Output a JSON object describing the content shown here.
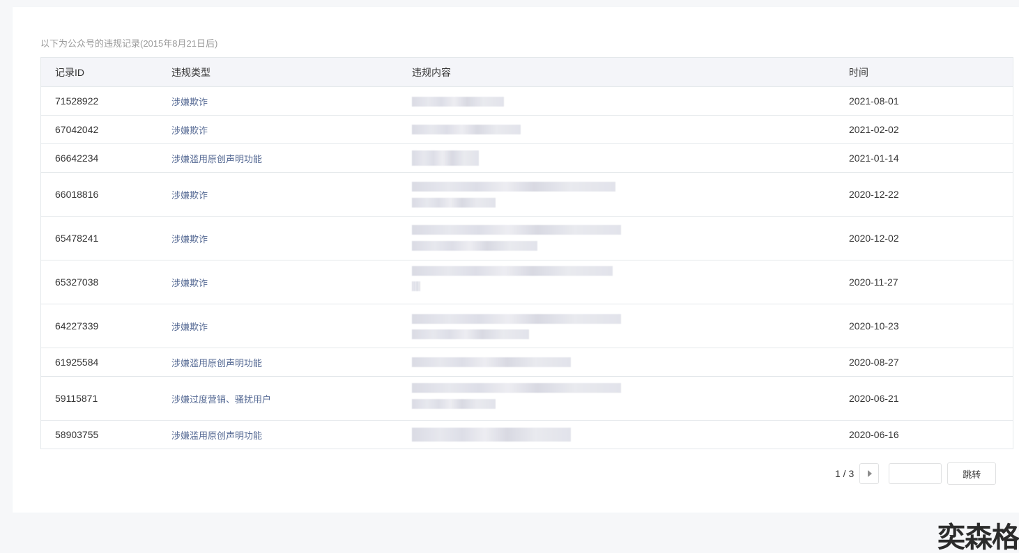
{
  "notice": "以下为公众号的违规记录(2015年8月21日后)",
  "table": {
    "headers": {
      "id": "记录ID",
      "type": "违规类型",
      "content": "违规内容",
      "time": "时间"
    },
    "rows": [
      {
        "id": "71528922",
        "type": "涉嫌欺诈",
        "time": "2021-08-01"
      },
      {
        "id": "67042042",
        "type": "涉嫌欺诈",
        "time": "2021-02-02"
      },
      {
        "id": "66642234",
        "type": "涉嫌滥用原创声明功能",
        "time": "2021-01-14"
      },
      {
        "id": "66018816",
        "type": "涉嫌欺诈",
        "time": "2020-12-22"
      },
      {
        "id": "65478241",
        "type": "涉嫌欺诈",
        "time": "2020-12-02"
      },
      {
        "id": "65327038",
        "type": "涉嫌欺诈",
        "time": "2020-11-27"
      },
      {
        "id": "64227339",
        "type": "涉嫌欺诈",
        "time": "2020-10-23"
      },
      {
        "id": "61925584",
        "type": "涉嫌滥用原创声明功能",
        "time": "2020-08-27"
      },
      {
        "id": "59115871",
        "type": "涉嫌过度营销、骚扰用户",
        "time": "2020-06-21"
      },
      {
        "id": "58903755",
        "type": "涉嫌滥用原创声明功能",
        "time": "2020-06-16"
      }
    ]
  },
  "pagination": {
    "indicator": "1 / 3",
    "jump_label": "跳转",
    "input_value": ""
  },
  "watermark": "奕森格"
}
